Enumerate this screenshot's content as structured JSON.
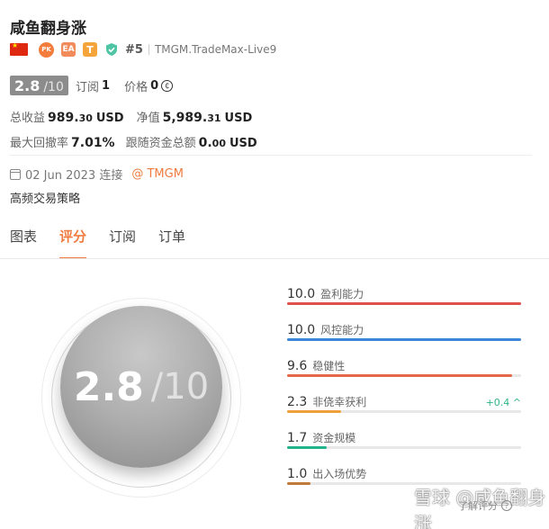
{
  "header": {
    "title": "咸鱼翻身涨",
    "badges": {
      "pk": "PK",
      "ea": "EA",
      "t": "T"
    },
    "rank": "#5",
    "server": "TMGM.TradeMax-Live9"
  },
  "score": {
    "value": "2.8",
    "max": "/10"
  },
  "meta": {
    "subscribe_label": "订阅",
    "subscribe_value": "1",
    "price_label": "价格",
    "price_value": "0"
  },
  "stats": {
    "total_profit_label": "总收益",
    "total_profit_int": "989.",
    "total_profit_dec": "30",
    "total_profit_cur": "USD",
    "net_label": "净值",
    "net_int": "5,989.",
    "net_dec": "31",
    "net_cur": "USD",
    "drawdown_label": "最大回撤率",
    "drawdown_value": "7.01%",
    "follow_label": "跟随资金总额",
    "follow_int": "0.",
    "follow_dec": "00",
    "follow_cur": "USD"
  },
  "info": {
    "date": "02 Jun 2023 连接",
    "broker": "@ TMGM",
    "strategy": "高频交易策略"
  },
  "tabs": [
    "图表",
    "评分",
    "订阅",
    "订单"
  ],
  "big_score": {
    "value": "2.8",
    "max": "/10"
  },
  "metrics": [
    {
      "value": "10.0",
      "name": "盈利能力",
      "level": 1.0,
      "color": "#e0514b",
      "delta": ""
    },
    {
      "value": "10.0",
      "name": "风控能力",
      "level": 1.0,
      "color": "#3b86d6",
      "delta": ""
    },
    {
      "value": "9.6",
      "name": "稳健性",
      "level": 0.96,
      "color": "#e6684a",
      "delta": ""
    },
    {
      "value": "2.3",
      "name": "非侥幸获利",
      "level": 0.23,
      "color": "#f0a03a",
      "delta": "+0.4 ^"
    },
    {
      "value": "1.7",
      "name": "资金规模",
      "level": 0.17,
      "color": "#22b38a",
      "delta": ""
    },
    {
      "value": "1.0",
      "name": "出入场优势",
      "level": 0.1,
      "color": "#c07a3a",
      "delta": ""
    }
  ],
  "footer": {
    "learn": "了解评分",
    "watermark": "雪球 @咸鱼翻身涨"
  },
  "colors": {
    "accent": "#f07b3f"
  }
}
